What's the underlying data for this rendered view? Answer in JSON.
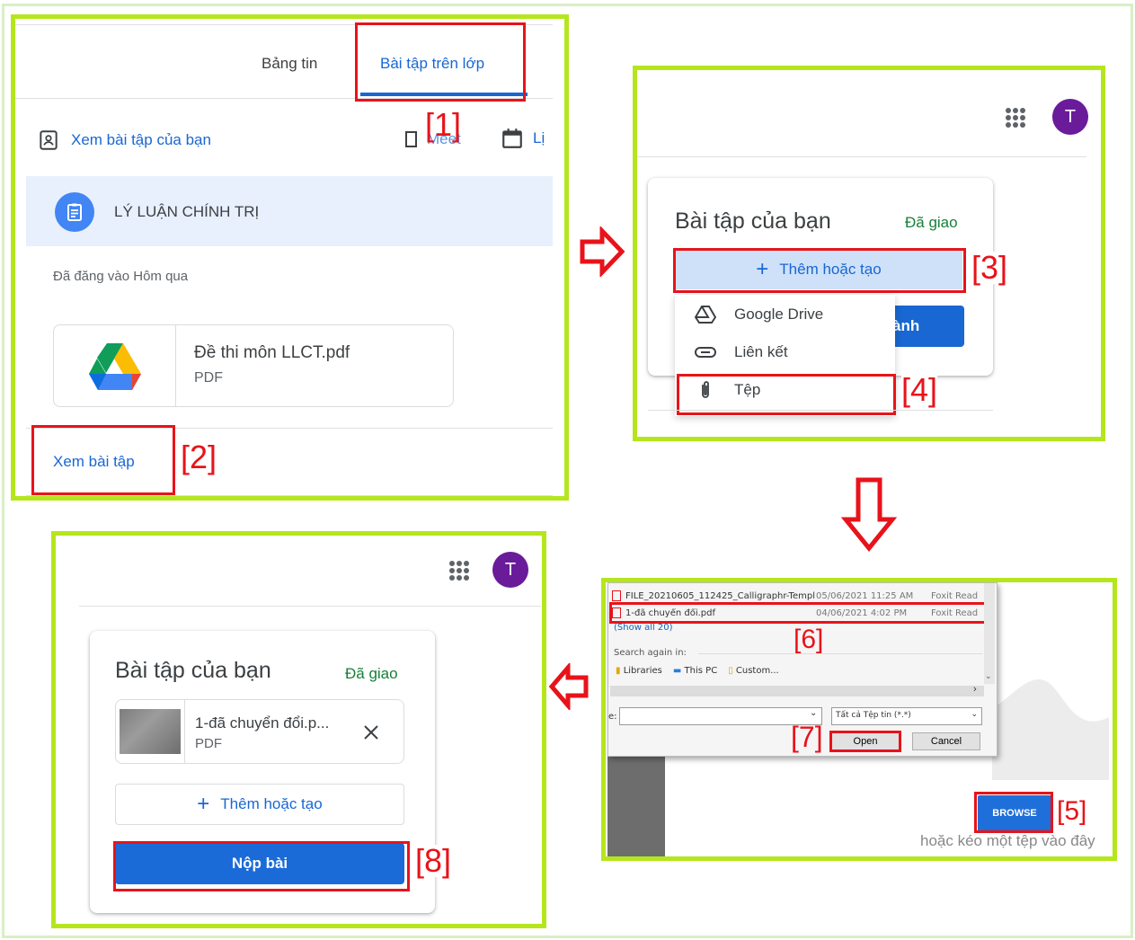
{
  "colors": {
    "frame": "#b5e61d",
    "callout": "#e8131a",
    "accent": "#1967d2",
    "avatar": "#6a1b9a",
    "arrow": "#e8131a"
  },
  "panel1": {
    "tabs": [
      "Bảng tin",
      "Bài tập trên lớp"
    ],
    "view_your_work": "Xem bài tập của bạn",
    "meet_label": "Meet",
    "calendar_label": "Lị",
    "topic_title": "LÝ LUẬN CHÍNH TRỊ",
    "posted": "Đã đăng vào Hôm qua",
    "attachment_name": "Đề thi môn LLCT.pdf",
    "attachment_type": "PDF",
    "view_assignment": "Xem bài tập",
    "callout_1": "[1]",
    "callout_2": "[2]"
  },
  "panel2": {
    "avatar_letter": "T",
    "card_title": "Bài tập của bạn",
    "status": "Đã giao",
    "add_or_create": "Thêm hoặc tạo",
    "mark_done_partial": "ành",
    "menu": [
      "Google Drive",
      "Liên kết",
      "Tệp"
    ],
    "callout_3": "[3]",
    "callout_4": "[4]"
  },
  "panel3": {
    "files": [
      {
        "name": "FILE_20210605_112425_Calligraphr-Templ...",
        "date": "05/06/2021 11:25 AM",
        "type": "Foxit Read"
      },
      {
        "name": "1-đã chuyển đổi.pdf",
        "date": "04/06/2021 4:02 PM",
        "type": "Foxit Read"
      }
    ],
    "show_all": "(Show all 20)",
    "search_again": "Search again in:",
    "locations": [
      "Libraries",
      "This PC",
      "Custom..."
    ],
    "filename_prefix": "e:",
    "filetype": "Tất cả Tệp tin (*.*)",
    "open": "Open",
    "cancel": "Cancel",
    "browse": "BROWSE",
    "drag_hint": "hoặc kéo một tệp vào đây",
    "callout_5": "[5]",
    "callout_6": "[6]",
    "callout_7": "[7]"
  },
  "panel4": {
    "avatar_letter": "T",
    "card_title": "Bài tập của bạn",
    "status": "Đã giao",
    "file_name": "1-đã chuyển đổi.p...",
    "file_type": "PDF",
    "add_or_create": "Thêm hoặc tạo",
    "submit": "Nộp bài",
    "callout_8": "[8]"
  }
}
